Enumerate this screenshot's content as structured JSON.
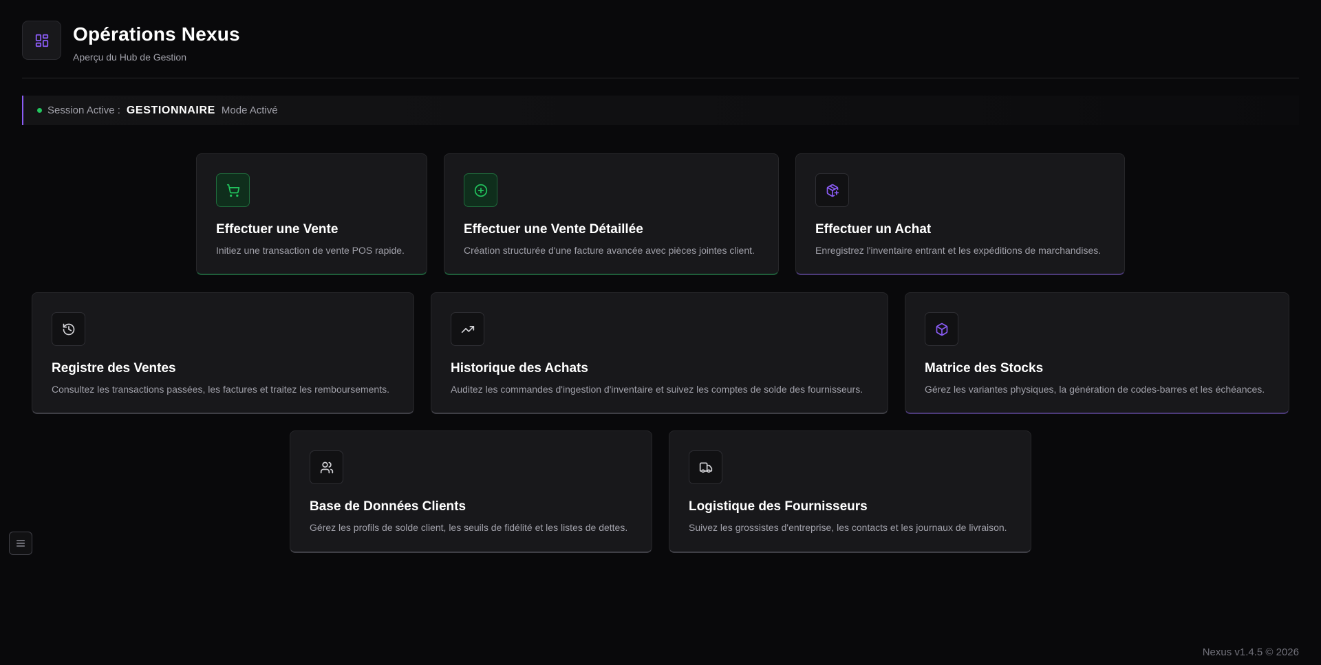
{
  "header": {
    "title": "Opérations Nexus",
    "subtitle": "Aperçu du Hub de Gestion",
    "logo_icon": "dashboard-grid-icon"
  },
  "session": {
    "label": "Session Active :",
    "role": "GESTIONNAIRE",
    "mode": "Mode Activé",
    "status_color": "#22c55e"
  },
  "cards": [
    {
      "title": "Effectuer une Vente",
      "description": "Initiez une transaction de vente POS rapide.",
      "icon": "cart-icon",
      "accent": "green"
    },
    {
      "title": "Effectuer une Vente Détaillée",
      "description": "Création structurée d'une facture avancée avec pièces jointes client.",
      "icon": "plus-circle-icon",
      "accent": "green"
    },
    {
      "title": "Effectuer un Achat",
      "description": "Enregistrez l'inventaire entrant et les expéditions de marchandises.",
      "icon": "package-plus-icon",
      "accent": "purple"
    },
    {
      "title": "Registre des Ventes",
      "description": "Consultez les transactions passées, les factures et traitez les remboursements.",
      "icon": "history-icon",
      "accent": "gray"
    },
    {
      "title": "Historique des Achats",
      "description": "Auditez les commandes d'ingestion d'inventaire et suivez les comptes de solde des fournisseurs.",
      "icon": "trending-up-icon",
      "accent": "gray"
    },
    {
      "title": "Matrice des Stocks",
      "description": "Gérez les variantes physiques, la génération de codes-barres et les échéances.",
      "icon": "box-icon",
      "accent": "purple"
    },
    {
      "title": "Base de Données Clients",
      "description": "Gérez les profils de solde client, les seuils de fidélité et les listes de dettes.",
      "icon": "users-icon",
      "accent": "gray"
    },
    {
      "title": "Logistique des Fournisseurs",
      "description": "Suivez les grossistes d'entreprise, les contacts et les journaux de livraison.",
      "icon": "truck-icon",
      "accent": "gray"
    }
  ],
  "colors": {
    "background": "#09090b",
    "card": "#18181b",
    "accent_purple": "#8b5cf6",
    "accent_green": "#22c55e"
  },
  "footer": {
    "version": "Nexus v1.4.5 © 2026"
  }
}
